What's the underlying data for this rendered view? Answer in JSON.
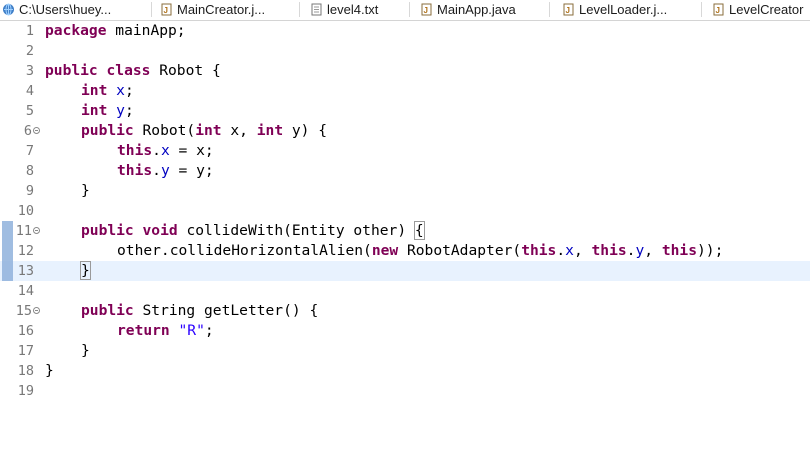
{
  "tabs": [
    {
      "label": "C:\\Users\\huey...",
      "icon": "globe-icon"
    },
    {
      "label": "MainCreator.j...",
      "icon": "java-file-icon"
    },
    {
      "label": "level4.txt",
      "icon": "text-file-icon"
    },
    {
      "label": "MainApp.java",
      "icon": "java-file-icon"
    },
    {
      "label": "LevelLoader.j...",
      "icon": "java-file-icon"
    },
    {
      "label": "LevelCreator",
      "icon": "java-file-icon"
    }
  ],
  "line_numbers": [
    "1",
    "2",
    "3",
    "4",
    "5",
    "6",
    "7",
    "8",
    "9",
    "10",
    "11",
    "12",
    "13",
    "14",
    "15",
    "16",
    "17",
    "18",
    "19"
  ],
  "code": {
    "l1_kw": "package",
    "l1_rest": " mainApp;",
    "l3_kw1": "public",
    "l3_kw2": "class",
    "l3_rest": " Robot {",
    "l4_kw": "int",
    "l4_fld": "x",
    "l4_end": ";",
    "l5_kw": "int",
    "l5_fld": "y",
    "l5_end": ";",
    "l6_kw1": "public",
    "l6_mid": " Robot(",
    "l6_kw2": "int",
    "l6_a": " x, ",
    "l6_kw3": "int",
    "l6_b": " y) {",
    "l7_kw": "this",
    "l7_dot": ".",
    "l7_fld": "x",
    "l7_rest": " = x;",
    "l8_kw": "this",
    "l8_dot": ".",
    "l8_fld": "y",
    "l8_rest": " = y;",
    "l9": "}",
    "l11_kw1": "public",
    "l11_kw2": "void",
    "l11_rest": " collideWith(Entity other) ",
    "l11_brace": "{",
    "l12_a": "other.collideHorizontalAlien(",
    "l12_kw1": "new",
    "l12_b": " RobotAdapter(",
    "l12_kw2": "this",
    "l12_c": ".",
    "l12_f1": "x",
    "l12_d": ", ",
    "l12_kw3": "this",
    "l12_e": ".",
    "l12_f2": "y",
    "l12_g": ", ",
    "l12_kw4": "this",
    "l12_h": "));",
    "l13": "}",
    "l15_kw": "public",
    "l15_rest": " String getLetter() {",
    "l16_kw": "return",
    "l16_sp": " ",
    "l16_str": "\"R\"",
    "l16_end": ";",
    "l17": "}",
    "l18": "}"
  },
  "fold_lines": [
    "6",
    "11",
    "15"
  ],
  "current_line": "13",
  "colors": {
    "keyword": "#7f0055",
    "field": "#0000c0",
    "string": "#2a00ff",
    "current_line_bg": "#e8f2fe"
  }
}
